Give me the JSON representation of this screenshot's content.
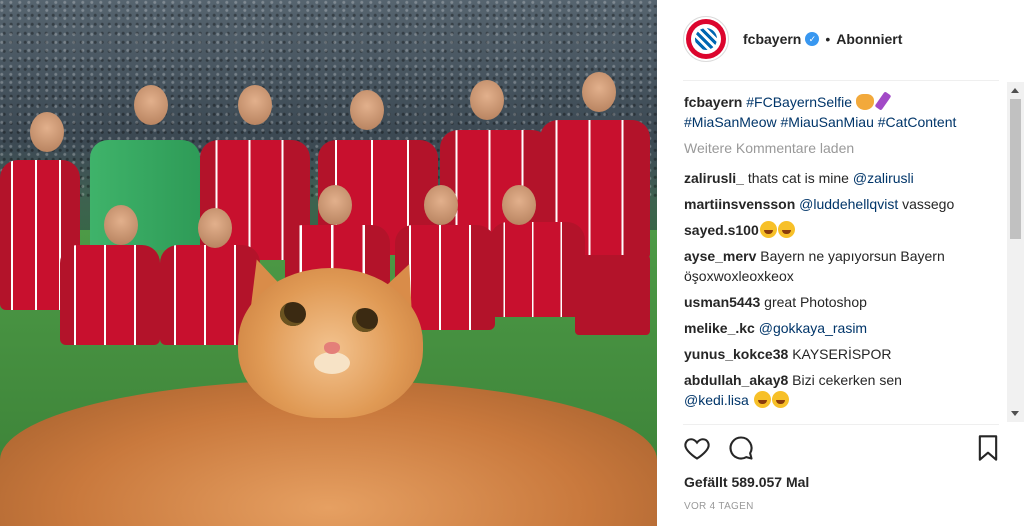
{
  "post": {
    "username": "fcbayern",
    "separator": "•",
    "follow_state": "Abonniert",
    "verified_mark": "✓"
  },
  "caption": {
    "user": "fcbayern",
    "text1": "#FCBayernSelfie",
    "text2": "#MiaSanMeow #MiauSanMiau #CatContent"
  },
  "load_more": "Weitere Kommentare laden",
  "comments": [
    {
      "user": "zalirusli_",
      "text": "thats cat is mine",
      "mention": "@zalirusli"
    },
    {
      "user": "martiinsvensson",
      "mention": "@luddehellqvist",
      "text": "vassego"
    },
    {
      "user": "sayed.s100",
      "text": ""
    },
    {
      "user": "ayse_merv",
      "text": "Bayern ne yapıyorsun Bayern öşoxwoxleoxkeox"
    },
    {
      "user": "usman5443",
      "text": "great Photoshop"
    },
    {
      "user": "melike_.kc",
      "mention": "@gokkaya_rasim"
    },
    {
      "user": "yunus_kokce38",
      "text": "KAYSERİSPOR"
    },
    {
      "user": "abdullah_akay8",
      "text": "Bizi cekerken sen",
      "mention": "@kedi.lisa"
    }
  ],
  "likes": "Gefällt 589.057 Mal",
  "timestamp": "VOR 4 TAGEN",
  "icons": {
    "like": "heart-icon",
    "comment": "comment-icon",
    "save": "bookmark-icon"
  },
  "colors": {
    "link": "#003569",
    "verified": "#3897f0",
    "muted": "#999999",
    "bayern_red": "#dc052d"
  }
}
